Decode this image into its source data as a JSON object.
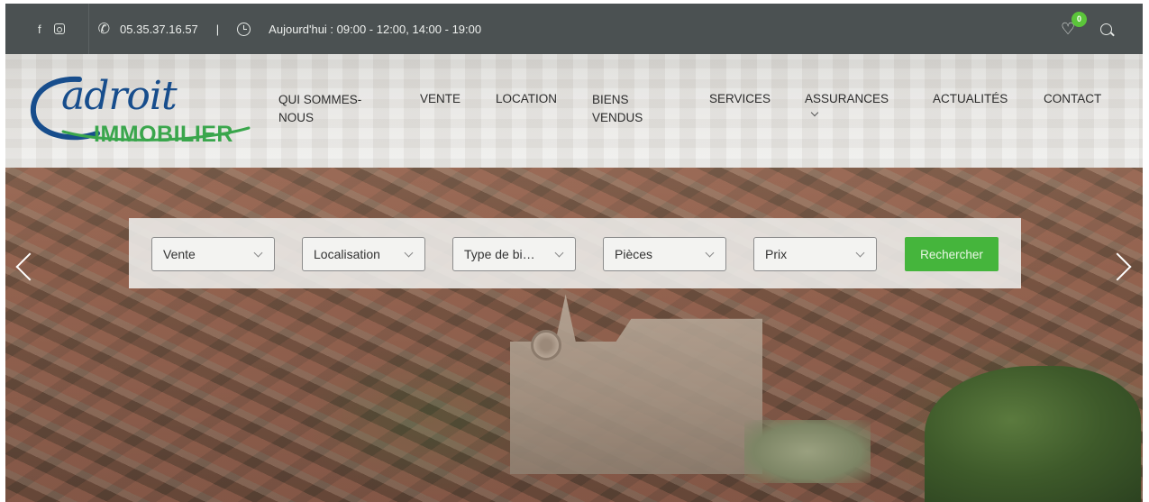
{
  "topbar": {
    "phone": "05.35.37.16.57",
    "separator": "|",
    "hours": "Aujourd'hui : 09:00 - 12:00, 14:00 - 19:00",
    "favorites_count": "0"
  },
  "logo": {
    "line1": "adroit",
    "line2": "IMMOBILIER"
  },
  "nav": {
    "items": [
      {
        "label_l1": "QUI SOMMES-",
        "label_l2": "NOUS"
      },
      {
        "label_l1": "VENTE",
        "label_l2": ""
      },
      {
        "label_l1": "LOCATION",
        "label_l2": ""
      },
      {
        "label_l1": "BIENS",
        "label_l2": "VENDUS"
      },
      {
        "label_l1": "SERVICES",
        "label_l2": ""
      },
      {
        "label_l1": "ASSURANCES",
        "label_l2": ""
      },
      {
        "label_l1": "ACTUALITÉS",
        "label_l2": ""
      },
      {
        "label_l1": "CONTACT",
        "label_l2": ""
      }
    ]
  },
  "search": {
    "transaction": "Vente",
    "location": "Localisation",
    "property_type": "Type de bi…",
    "rooms": "Pièces",
    "price": "Prix",
    "submit_label": "Rechercher"
  },
  "colors": {
    "topbar_bg": "#4b5152",
    "logo_blue": "#174d8c",
    "logo_green": "#3aa64c",
    "search_button": "#45b53c",
    "badge": "#5bc53a"
  },
  "icons": [
    "facebook-icon",
    "instagram-icon",
    "phone-icon",
    "clock-icon",
    "heart-icon",
    "search-icon",
    "chevron-left-icon",
    "chevron-right-icon"
  ]
}
